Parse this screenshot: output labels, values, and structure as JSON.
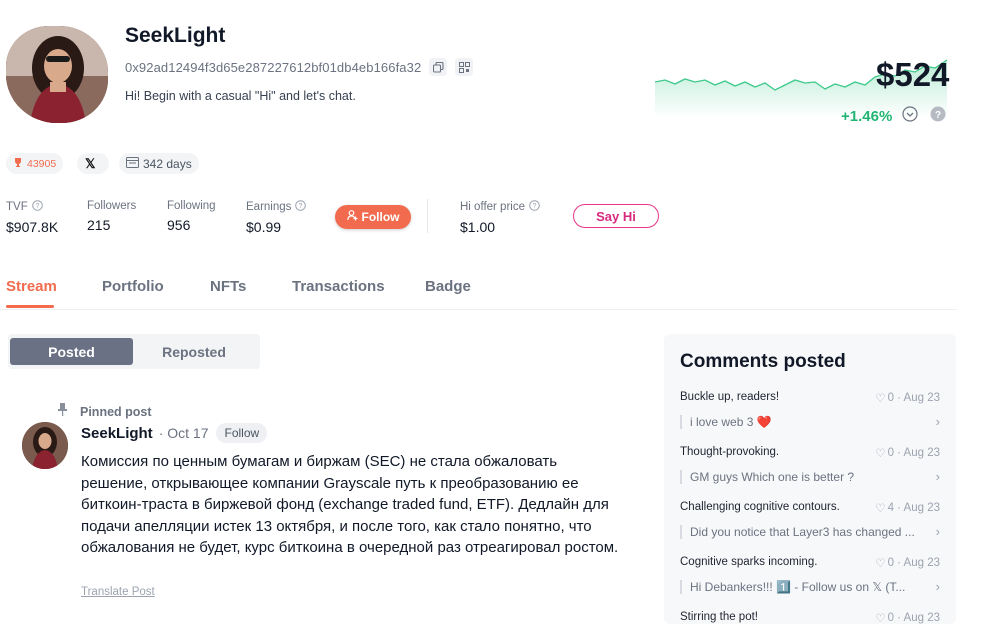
{
  "profile": {
    "name": "SeekLight",
    "address": "0x92ad12494f3d65e287227612bf01db4eb166fa32",
    "bio": "Hi! Begin with a casual \"Hi\" and let's chat.",
    "price": "$524",
    "change": "+1.46%",
    "rank": "43905",
    "days": "342 days"
  },
  "stats": [
    {
      "label": "TVF",
      "value": "$907.8K"
    },
    {
      "label": "Followers",
      "value": "215"
    },
    {
      "label": "Following",
      "value": "956"
    },
    {
      "label": "Earnings",
      "value": "$0.99"
    }
  ],
  "hi_offer": {
    "label": "Hi offer price",
    "value": "$1.00"
  },
  "buttons": {
    "follow": "Follow",
    "say_hi": "Say Hi"
  },
  "tabs": [
    "Stream",
    "Portfolio",
    "NFTs",
    "Transactions",
    "Badge"
  ],
  "segments": [
    "Posted",
    "Reposted"
  ],
  "post": {
    "pinned_label": "Pinned post",
    "author": "SeekLight",
    "date": "· Oct 17",
    "follow_label": "Follow",
    "body": "Комиссия по ценным бумагам и биржам (SEC) не стала обжаловать решение, открывающее компании Grayscale путь к преобразованию ее биткоин-траста в биржевой фонд (exchange traded fund, ETF). Дедлайн для подачи апелляции истек 13 октября, и после того, как стало понятно, что обжалования не будет, курс биткоина в очередной раз отреагировал ростом.",
    "translate": "Translate Post"
  },
  "sidebar": {
    "title": "Comments posted",
    "comments": [
      {
        "title": "Buckle up, readers!",
        "meta": "0 · Aug 23",
        "reply": "i love web 3 ❤️"
      },
      {
        "title": "Thought-provoking.",
        "meta": "0 · Aug 23",
        "reply": "GM guys Which one is better ?"
      },
      {
        "title": "Challenging cognitive contours.",
        "meta": "4 · Aug 23",
        "reply": "Did you notice that Layer3 has changed ..."
      },
      {
        "title": "Cognitive sparks incoming.",
        "meta": "0 · Aug 23",
        "reply": "Hi Debankers!!! 1️⃣ - Follow us on 𝕏 (T..."
      },
      {
        "title": "Stirring the pot!",
        "meta": "0 · Aug 23",
        "reply": ""
      }
    ]
  },
  "colors": {
    "accent": "#f26b4f",
    "positive": "#22b573",
    "pink": "#e6348a"
  }
}
